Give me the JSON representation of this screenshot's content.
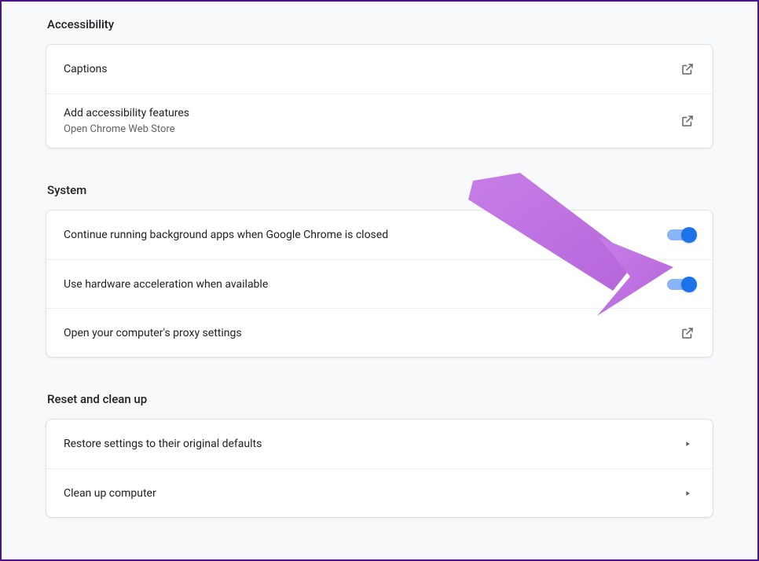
{
  "sections": {
    "accessibility": {
      "title": "Accessibility",
      "captions": {
        "label": "Captions"
      },
      "addFeatures": {
        "label": "Add accessibility features",
        "sub": "Open Chrome Web Store"
      }
    },
    "system": {
      "title": "System",
      "bgApps": {
        "label": "Continue running background apps when Google Chrome is closed"
      },
      "hwAccel": {
        "label": "Use hardware acceleration when available"
      },
      "proxy": {
        "label": "Open your computer's proxy settings"
      }
    },
    "reset": {
      "title": "Reset and clean up",
      "restore": {
        "label": "Restore settings to their original defaults"
      },
      "cleanup": {
        "label": "Clean up computer"
      }
    }
  },
  "annotation": {
    "color": "#c47ee8",
    "target": "hw-accel-toggle"
  }
}
